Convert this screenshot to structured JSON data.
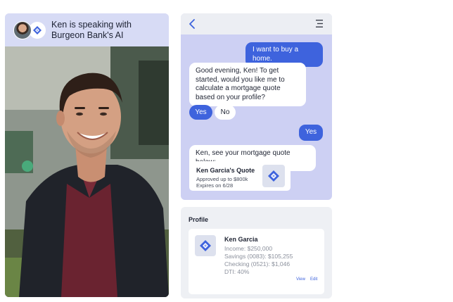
{
  "header": {
    "line1": "Ken is speaking with",
    "line2": "Burgeon Bank's AI"
  },
  "icons": {
    "avatar": "user-avatar",
    "bank_logo": "burgeon-bank-logo",
    "back": "chevron-left-icon",
    "menu": "menu-icon"
  },
  "chat": {
    "messages": [
      {
        "role": "user",
        "text": "I want to buy a home."
      },
      {
        "role": "bot",
        "text": "Good evening, Ken! To get started, would you like me to calculate a mortgage quote based on your profile?"
      },
      {
        "role": "user",
        "text": "Yes"
      },
      {
        "role": "bot",
        "text": "Ken, see your mortgage quote below:"
      }
    ],
    "options": {
      "yes": "Yes",
      "no": "No"
    },
    "quote": {
      "title": "Ken Garcia's Quote",
      "approved": "Approved up to $800k",
      "expires": "Expires on 6/28"
    }
  },
  "profile": {
    "title": "Profile",
    "name": "Ken Garcia",
    "income": "Income: $250,000",
    "savings": "Savings (0083): $105,255",
    "checking": "Checking (0521): $1,046",
    "dti": "DTI: 40%",
    "view_label": "View",
    "edit_label": "Edit"
  },
  "colors": {
    "accent": "#3e63dd",
    "chat_bg": "#cdd0f3",
    "header_bg": "#d7dbf5",
    "logo_blue": "#3e63dd",
    "logo_light": "#8fa6f0"
  }
}
